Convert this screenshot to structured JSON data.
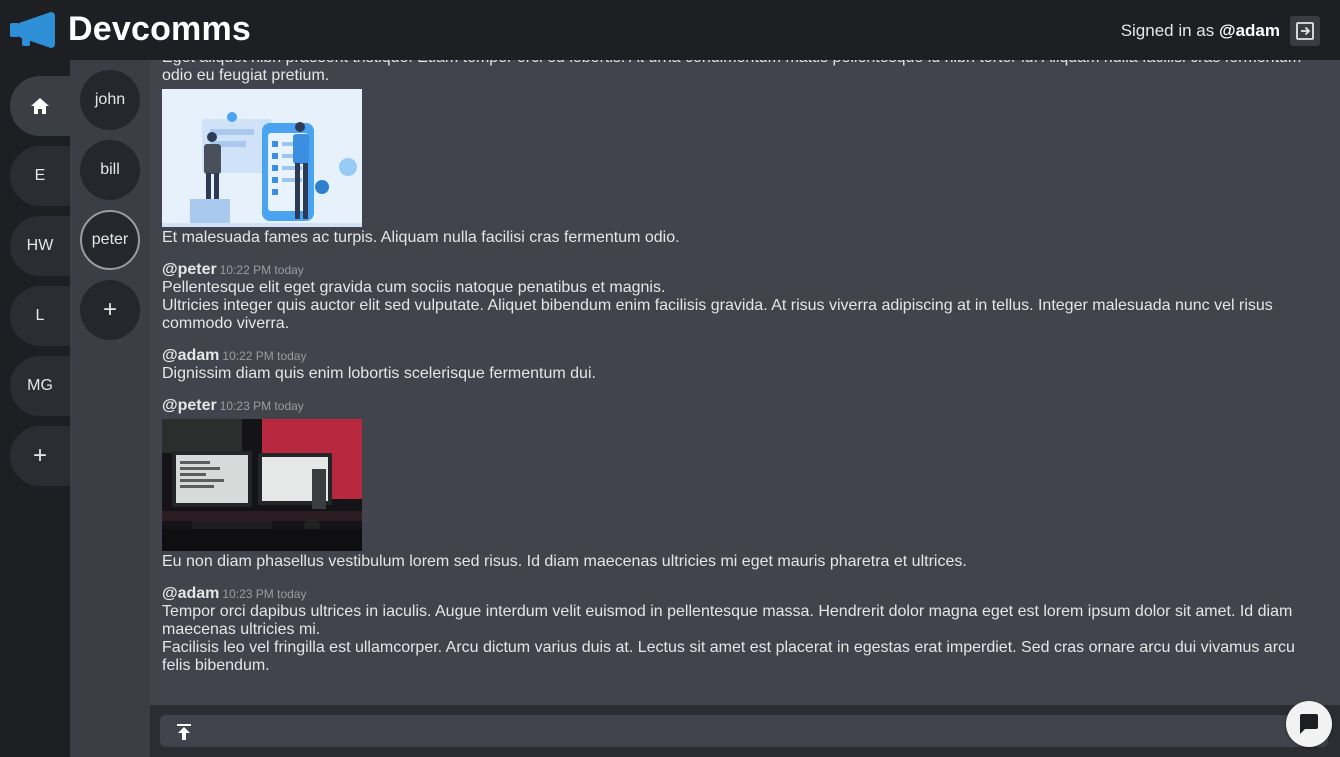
{
  "app": {
    "name": "Devcomms",
    "signed_in_prefix": "Signed in as",
    "user": "@adam",
    "logo_icon": "megaphone-icon",
    "accent": "#2e8fd6"
  },
  "servers": [
    {
      "label": "",
      "icon": "home-icon",
      "active": true
    },
    {
      "label": "E"
    },
    {
      "label": "HW"
    },
    {
      "label": "L"
    },
    {
      "label": "MG"
    },
    {
      "label": "+",
      "icon": "plus-icon"
    }
  ],
  "channels": [
    {
      "label": "john"
    },
    {
      "label": "bill"
    },
    {
      "label": "peter",
      "active": true
    },
    {
      "label": "+",
      "icon": "plus-icon"
    }
  ],
  "messages": {
    "m0": {
      "line1": "Eget aliquet nibh praesent tristique. Etiam tempor orci eu lobortis. At urna condimentum mattis pellentesque id nibh tortor id. Aliquam nulla facilisi cras fermentum odio eu feugiat pretium.",
      "line2": "Et malesuada fames ac turpis. Aliquam nulla facilisi cras fermentum odio."
    },
    "m1": {
      "author": "@peter",
      "time": "10:22 PM today",
      "lines": [
        "Pellentesque elit eget gravida cum sociis natoque penatibus et magnis.",
        "Ultricies integer quis auctor elit sed vulputate. Aliquet bibendum enim facilisis gravida. At risus viverra adipiscing at in tellus. Integer malesuada nunc vel risus commodo viverra."
      ]
    },
    "m2": {
      "author": "@adam",
      "time": "10:22 PM today",
      "lines": [
        "Dignissim diam quis enim lobortis scelerisque fermentum dui."
      ]
    },
    "m3": {
      "author": "@peter",
      "time": "10:23 PM today",
      "lines": [
        "Eu non diam phasellus vestibulum lorem sed risus. Id diam maecenas ultricies mi eget mauris pharetra et ultrices."
      ]
    },
    "m4": {
      "author": "@adam",
      "time": "10:23 PM today",
      "lines": [
        "Tempor orci dapibus ultrices in iaculis. Augue interdum velit euismod in pellentesque massa. Hendrerit dolor magna eget est lorem ipsum dolor sit amet. Id diam maecenas ultricies mi.",
        "Facilisis leo vel fringilla est ullamcorper. Arcu dictum varius duis at. Lectus sit amet est placerat in egestas erat imperdiet. Sed cras ornare arcu dui vivamus arcu felis bibendum."
      ]
    }
  },
  "composer": {
    "attach_icon": "upload-icon",
    "send_icon": "chat-bubble-icon",
    "value": ""
  }
}
